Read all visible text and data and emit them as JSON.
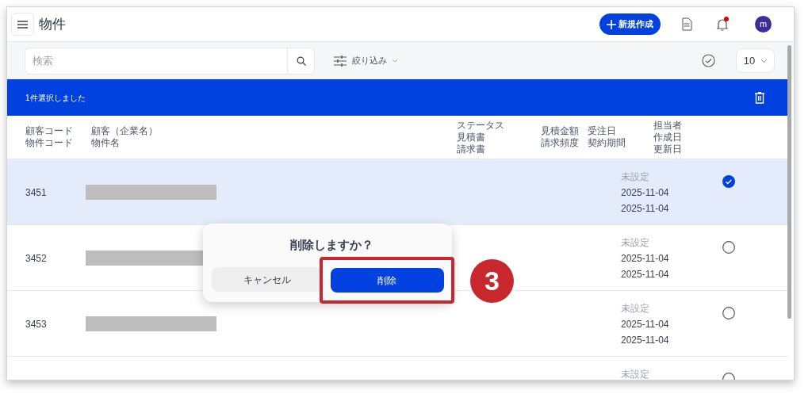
{
  "app_bar": {
    "title": "物件",
    "new_button": "新規作成",
    "avatar": "m",
    "notification_unread": true
  },
  "toolbar": {
    "search_placeholder": "検索",
    "filter_label": "絞り込み",
    "page_size": "10"
  },
  "selection_bar": {
    "text": "1件選択しました"
  },
  "columns": [
    {
      "lines": [
        "顧客コード",
        "物件コード"
      ]
    },
    {
      "lines": [
        "顧客（企業名）",
        "物件名"
      ]
    },
    {
      "lines": [
        "ステータス",
        "見積書",
        "請求書"
      ]
    },
    {
      "lines": [
        "見積金額",
        "請求頻度"
      ]
    },
    {
      "lines": [
        "受注日",
        "契約期間"
      ]
    },
    {
      "lines": [
        "担当者",
        "作成日",
        "更新日"
      ]
    }
  ],
  "rows": [
    {
      "code": "3451",
      "assignee": "未設定",
      "created": "2025-11-04",
      "updated": "2025-11-04",
      "selected": true
    },
    {
      "code": "3452",
      "assignee": "未設定",
      "created": "2025-11-04",
      "updated": "2025-11-04",
      "selected": false
    },
    {
      "code": "3453",
      "assignee": "未設定",
      "created": "2025-11-04",
      "updated": "2025-11-04",
      "selected": false
    },
    {
      "assignee": "未設定",
      "selected": false
    }
  ],
  "dialog": {
    "title": "削除しますか？",
    "cancel": "キャンセル",
    "confirm": "削除"
  },
  "callout": {
    "number": "3"
  }
}
